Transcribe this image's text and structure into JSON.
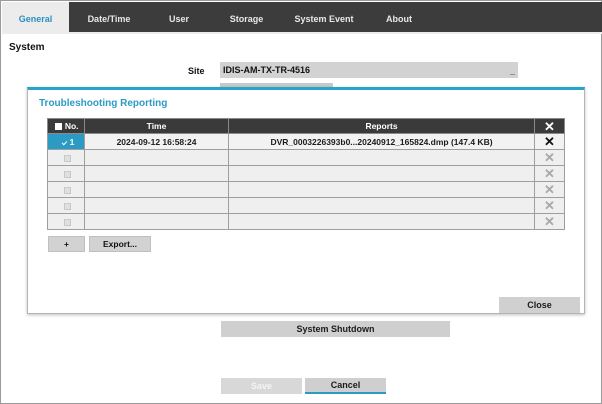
{
  "tabs": [
    {
      "label": "General",
      "active": true
    },
    {
      "label": "Date/Time",
      "active": false
    },
    {
      "label": "User",
      "active": false
    },
    {
      "label": "Storage",
      "active": false
    },
    {
      "label": "System Event",
      "active": false
    },
    {
      "label": "About",
      "active": false
    }
  ],
  "section": {
    "title": "System"
  },
  "site": {
    "label": "Site",
    "value": "IDIS-AM-TX-TR-4516",
    "cursor": "_"
  },
  "dialog": {
    "title": "Troubleshooting Reporting",
    "columns": {
      "no": "No.",
      "time": "Time",
      "reports": "Reports",
      "delete_icon": "close-icon"
    },
    "rows": [
      {
        "checked": true,
        "no": "1",
        "time": "2024-09-12 16:58:24",
        "report": "DVR_0003226393b0...20240912_165824.dmp (147.4 KB)"
      },
      {
        "checked": false,
        "no": "",
        "time": "",
        "report": ""
      },
      {
        "checked": false,
        "no": "",
        "time": "",
        "report": ""
      },
      {
        "checked": false,
        "no": "",
        "time": "",
        "report": ""
      },
      {
        "checked": false,
        "no": "",
        "time": "",
        "report": ""
      },
      {
        "checked": false,
        "no": "",
        "time": "",
        "report": ""
      }
    ],
    "add_label": "+",
    "export_label": "Export...",
    "close_label": "Close"
  },
  "shutdown_label": "System Shutdown",
  "footer": {
    "save_label": "Save",
    "cancel_label": "Cancel"
  },
  "colors": {
    "accent": "#2b9bc4",
    "tabbar": "#3c3c3c",
    "button": "#d0d0d0"
  }
}
